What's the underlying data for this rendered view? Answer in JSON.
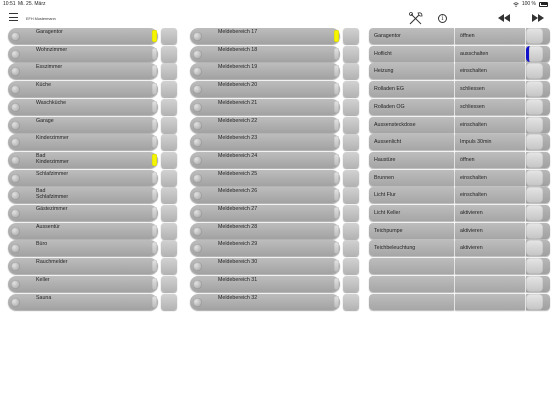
{
  "status": {
    "time": "10:51",
    "date": "Mi. 25. März",
    "battery": "100 %"
  },
  "nav": {
    "title": "EFH Mustermann"
  },
  "col1": [
    {
      "label": "Garagentor",
      "led": true
    },
    {
      "label": "Wohnzimmer",
      "led": false
    },
    {
      "label": "Esszimmer",
      "led": false
    },
    {
      "label": "Küche",
      "led": false
    },
    {
      "label": "Waschküche",
      "led": false
    },
    {
      "label": "Garage",
      "led": false
    },
    {
      "label": "Kinderzimmer",
      "led": false
    },
    {
      "label": "Bad\nKinderzimmer",
      "led": true
    },
    {
      "label": "Schlafzimmer",
      "led": false
    },
    {
      "label": "Bad\nSchlafzimmer",
      "led": false
    },
    {
      "label": "Gästezimmer",
      "led": false
    },
    {
      "label": "Aussentür",
      "led": false
    },
    {
      "label": "Büro",
      "led": false
    },
    {
      "label": "Rauchmelder",
      "led": false
    },
    {
      "label": "Keller",
      "led": false
    },
    {
      "label": "Sauna",
      "led": false
    }
  ],
  "col2": [
    {
      "label": "Meldebereich 17",
      "led": true
    },
    {
      "label": "Meldebereich 18",
      "led": false
    },
    {
      "label": "Meldebereich 19",
      "led": false
    },
    {
      "label": "Meldebereich 20",
      "led": false
    },
    {
      "label": "Meldebereich 21",
      "led": false
    },
    {
      "label": "Meldebereich 22",
      "led": false
    },
    {
      "label": "Meldebereich 23",
      "led": false
    },
    {
      "label": "Meldebereich 24",
      "led": false
    },
    {
      "label": "Meldebereich 25",
      "led": false
    },
    {
      "label": "Meldebereich 26",
      "led": false
    },
    {
      "label": "Meldebereich 27",
      "led": false
    },
    {
      "label": "Meldebereich 28",
      "led": false
    },
    {
      "label": "Meldebereich 29",
      "led": false
    },
    {
      "label": "Meldebereich 30",
      "led": false
    },
    {
      "label": "Meldebereich 31",
      "led": false
    },
    {
      "label": "Meldebereich 32",
      "led": false
    }
  ],
  "col3": [
    {
      "name": "Garagentor",
      "action": "öffnen",
      "on": false
    },
    {
      "name": "Hoflicht",
      "action": "ausschalten",
      "on": true
    },
    {
      "name": "Heizung",
      "action": "einschalten",
      "on": false
    },
    {
      "name": "Rolladen EG",
      "action": "schliessen",
      "on": false
    },
    {
      "name": "Rolladen OG",
      "action": "schliessen",
      "on": false
    },
    {
      "name": "Aussensteckdose",
      "action": "einschalten",
      "on": false
    },
    {
      "name": "Aussenlicht",
      "action": "Impuls 30min",
      "on": false
    },
    {
      "name": "Haustüre",
      "action": "öffnen",
      "on": false
    },
    {
      "name": "Brunnen",
      "action": "einschalten",
      "on": false
    },
    {
      "name": "Licht Flur",
      "action": "einschalten",
      "on": false
    },
    {
      "name": "Licht Keller",
      "action": "aktivieren",
      "on": false
    },
    {
      "name": "Teichpumpe",
      "action": "aktivieren",
      "on": false
    },
    {
      "name": "Teichbeleuchtung",
      "action": "aktivieren",
      "on": false
    },
    {
      "name": "",
      "action": "",
      "on": false
    },
    {
      "name": "",
      "action": "",
      "on": false
    },
    {
      "name": "",
      "action": "",
      "on": false
    }
  ],
  "colors": {
    "led_on": "#f5f500",
    "switch_on": "#1111cc",
    "panel": "#b0b0b0"
  },
  "icons": {
    "menu": "hamburger-icon",
    "tool": "tools-icon",
    "info": "info-icon",
    "rewind": "rewind-icon",
    "forward": "fast-forward-icon",
    "wifi": "wifi-icon",
    "battery": "battery-icon"
  }
}
